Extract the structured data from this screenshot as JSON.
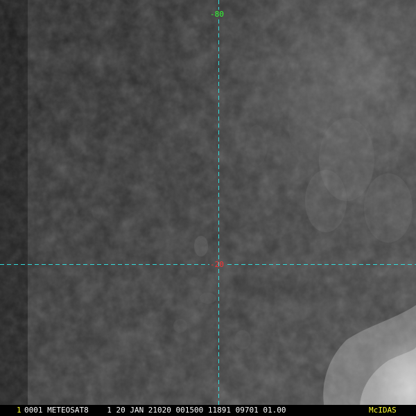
{
  "image": {
    "type": "satellite-imagery"
  },
  "gridlines": {
    "longitude_label": "-80",
    "latitude_label": "-20",
    "line_color": "#33dddd",
    "longitude_label_color": "#33ff33",
    "latitude_label_color": "#ff3333"
  },
  "caption": {
    "frame_number": "1",
    "text": "0001 METEOSAT8    1 20 JAN 21020 001500 11891 09701 01.00",
    "logo": "McIDAS"
  }
}
